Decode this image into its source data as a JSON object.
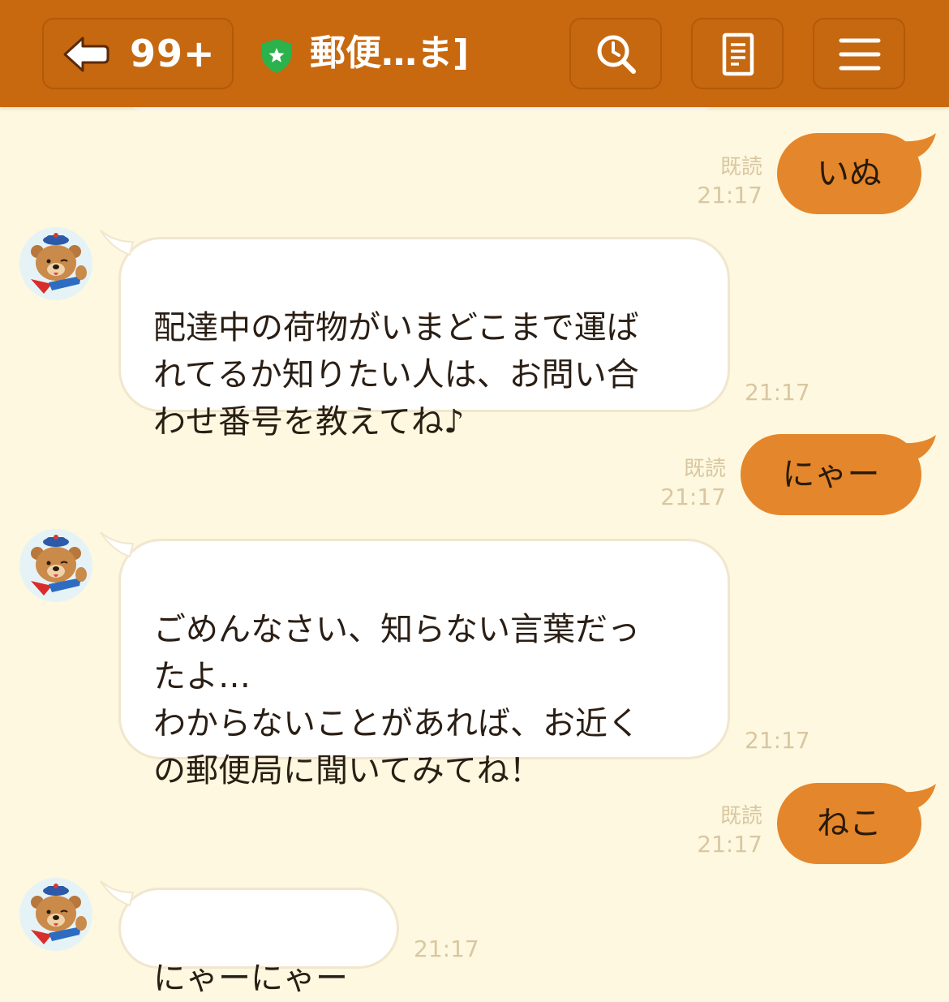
{
  "header": {
    "unread_count": "99+",
    "title": "郵便…ま]",
    "colors": {
      "bar": "#c8680f",
      "shield": "#2bb24c"
    },
    "icons": [
      "back-arrow-icon",
      "verified-shield-icon",
      "search-icon",
      "notes-icon",
      "menu-icon"
    ]
  },
  "messages": [
    {
      "side": "sent",
      "text": "いぬ",
      "read": "既読",
      "time": "21:17"
    },
    {
      "side": "received",
      "text": "配達中の荷物がいまどこまで運ば\nれてるか知りたい人は、お問い合\nわせ番号を教えてね♪",
      "time": "21:17"
    },
    {
      "side": "sent",
      "text": "にゃー",
      "read": "既読",
      "time": "21:17"
    },
    {
      "side": "received",
      "text": "ごめんなさい、知らない言葉だっ\nたよ…\nわからないことがあれば、お近く\nの郵便局に聞いてみてね！",
      "time": "21:17"
    },
    {
      "side": "sent",
      "text": "ねこ",
      "read": "既読",
      "time": "21:17"
    },
    {
      "side": "received",
      "text": "にゃーにゃー",
      "time": "21:17"
    }
  ],
  "colors": {
    "background": "#fdf8df",
    "sent_bubble": "#e4862b",
    "received_bubble": "#ffffff"
  }
}
